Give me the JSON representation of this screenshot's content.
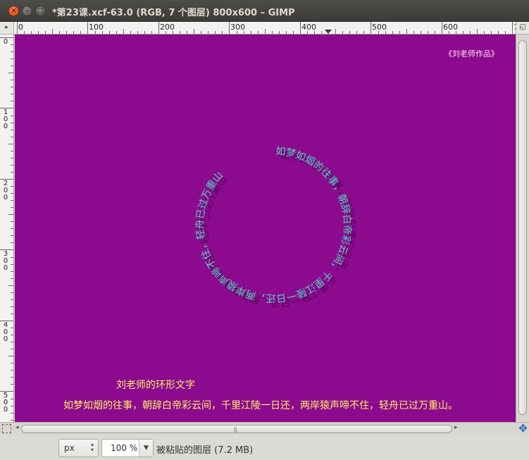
{
  "window": {
    "title": "*第23课.xcf-63.0 (RGB, 7 个图层) 800x600 – GIMP",
    "close_glyph": "×",
    "min_glyph": "–",
    "max_glyph": "□"
  },
  "rulers": {
    "horizontal_labels": [
      "0",
      "100",
      "200",
      "300",
      "400",
      "500",
      "600",
      "7"
    ],
    "vertical_labels": [
      "0",
      "100",
      "200",
      "300",
      "400",
      "500"
    ]
  },
  "canvas": {
    "background_color": "#8b0a8e",
    "signature_text": "《刘老师作品》",
    "ring_text": "如梦如烟的往事，朝辞白帝彩云间，千里江陵一日还，两岸猿声啼不住，轻舟已过万重山。",
    "caption_title": "刘老师的环形文字",
    "caption_poem": "如梦如烟的往事，朝辞白帝彩云间，千里江陵一日还，两岸猿声啼不住，轻舟已过万重山。"
  },
  "statusbar": {
    "unit_value": "px",
    "zoom_value": "100 %",
    "layer_info": "被粘贴的图层 (7.2 MB)"
  },
  "icons": {
    "ruler_corner": "menu-arrow-icon",
    "navigate": "navigate-icon",
    "quick_mask": "quick-mask-icon",
    "move": "move-icon"
  }
}
